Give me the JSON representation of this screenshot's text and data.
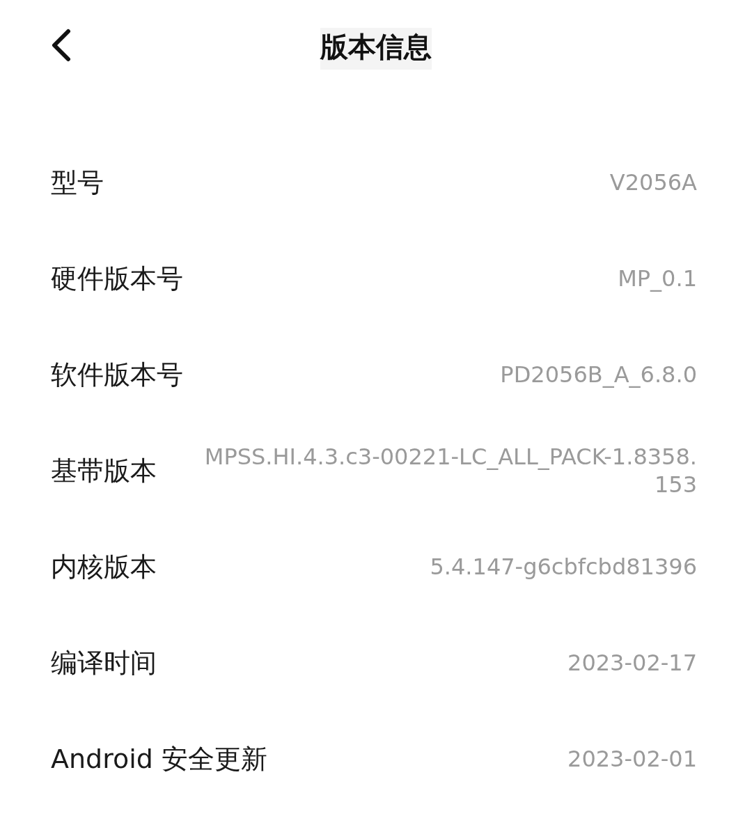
{
  "header": {
    "title": "版本信息"
  },
  "rows": [
    {
      "label": "型号",
      "value": "V2056A"
    },
    {
      "label": "硬件版本号",
      "value": "MP_0.1"
    },
    {
      "label": "软件版本号",
      "value": "PD2056B_A_6.8.0"
    },
    {
      "label": "基带版本",
      "value": "MPSS.HI.4.3.c3-00221-LC_ALL_PACK-1.8358.153"
    },
    {
      "label": "内核版本",
      "value": "5.4.147-g6cbfcbd81396"
    },
    {
      "label": "编译时间",
      "value": "2023-02-17"
    },
    {
      "label": "Android 安全更新",
      "value": "2023-02-01"
    }
  ]
}
